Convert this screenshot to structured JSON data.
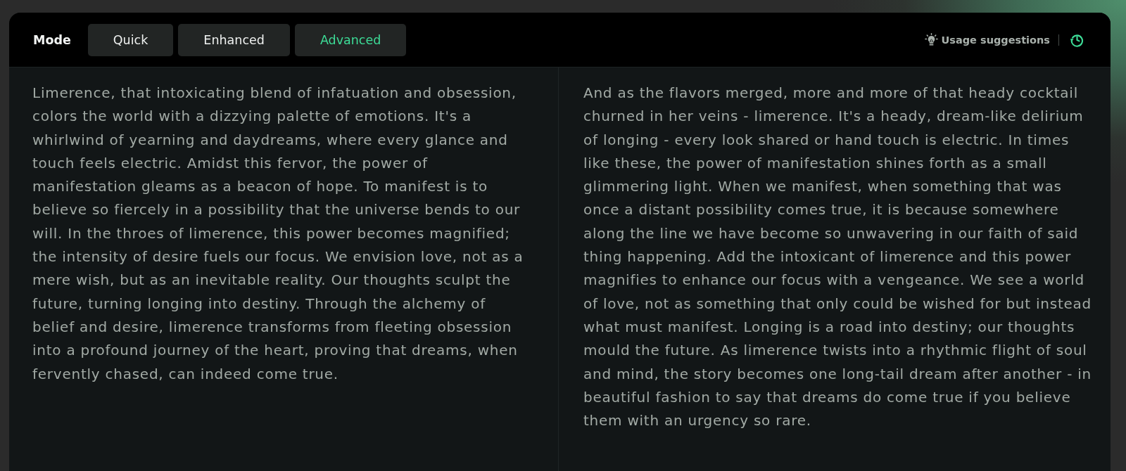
{
  "header": {
    "mode_label": "Mode",
    "tabs": [
      {
        "label": "Quick",
        "selected": false
      },
      {
        "label": "Enhanced",
        "selected": false
      },
      {
        "label": "Advanced",
        "selected": true
      }
    ],
    "usage_suggestions": "Usage suggestions"
  },
  "panels": [
    {
      "text": "Limerence, that intoxicating blend of infatuation and obsession, colors the world with a dizzying palette of emotions. It's a whirlwind of yearning and daydreams, where every glance and touch feels electric. Amidst this fervor, the power of manifestation gleams as a beacon of hope. To manifest is to believe so fiercely in a possibility that the universe bends to our will. In the throes of limerence, this power becomes magnified; the intensity of desire fuels our focus. We envision love, not as a mere wish, but as an inevitable reality. Our thoughts sculpt the future, turning longing into destiny. Through the alchemy of belief and desire, limerence transforms from fleeting obsession into a profound journey of the heart, proving that dreams, when fervently chased, can indeed come true."
    },
    {
      "text": "And as the flavors merged, more and more of that heady cocktail churned in her veins - limerence. It's a heady, dream-like delirium of longing - every look shared or hand touch is electric. In times like these, the power of manifestation shines forth as a small glimmering light. When we manifest, when something that was once a distant possibility comes true, it is because somewhere along the line we have become so unwavering in our faith of said thing happening. Add the intoxicant of limerence and this power magnifies to enhance our focus with a vengeance. We see a world of love, not as something that only could be wished for but instead what must manifest. Longing is a road into destiny; our thoughts mould the future. As limerence twists into a rhythmic flight of soul and mind, the story becomes one long-tail dream after another - in beautiful fashion to say that dreams do come true if you believe them with an urgency so rare."
    }
  ]
}
